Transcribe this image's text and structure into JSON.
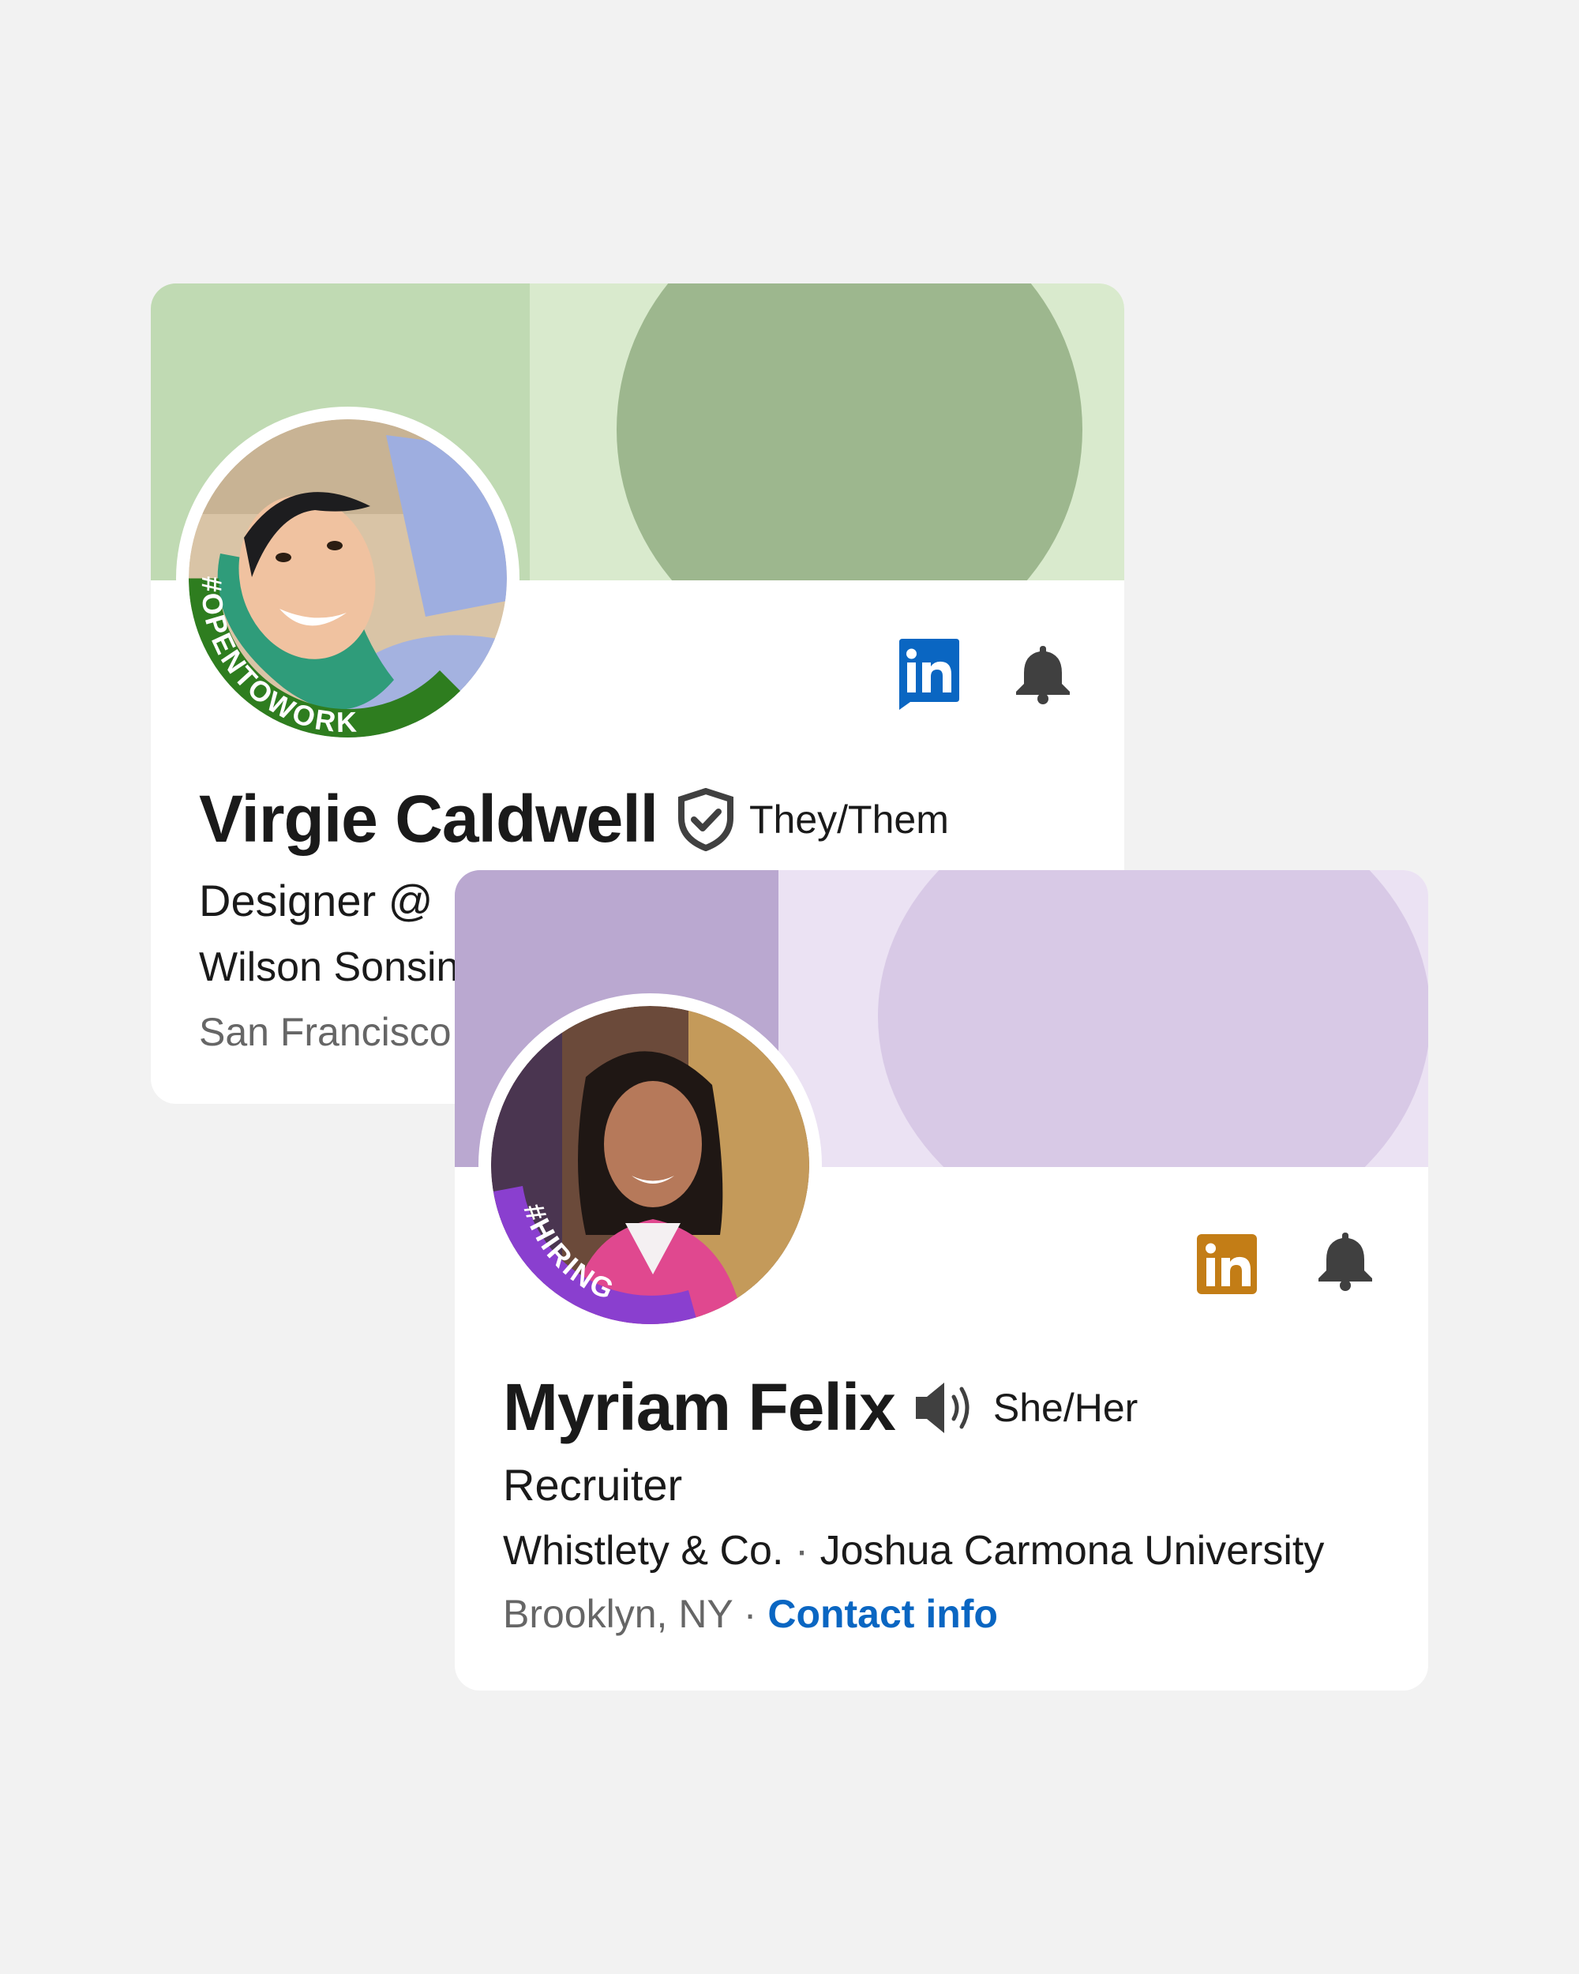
{
  "cards": [
    {
      "name": "Virgie Caldwell",
      "pronouns": "They/Them",
      "badge_icon": "verified-shield-icon",
      "frame_label": "#OPENTOWORK",
      "headline": "Designer @",
      "company": "Wilson Sonsin",
      "location": "San Francisco",
      "accent_color": "#2e7d1f",
      "linkedin_icon_color": "#0a66c2"
    },
    {
      "name": "Myriam Felix",
      "pronouns": "She/Her",
      "badge_icon": "speaker-pronunciation-icon",
      "frame_label": "#HIRING",
      "headline": "Recruiter",
      "company": "Whistlety & Co.",
      "separator": "·",
      "school": "Joshua Carmona University",
      "location": "Brooklyn, NY",
      "contact_link": "Contact info",
      "accent_color": "#8a3fcf",
      "linkedin_icon_color": "#c37d16"
    }
  ]
}
